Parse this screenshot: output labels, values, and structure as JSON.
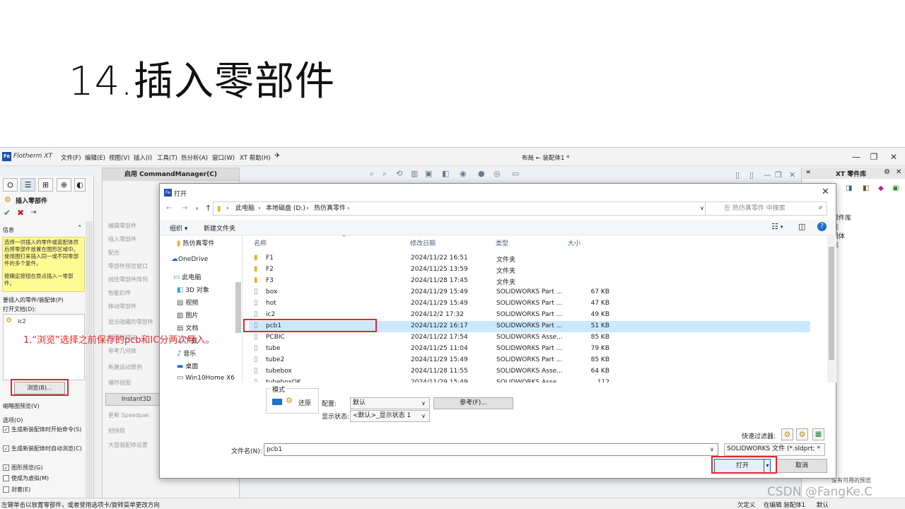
{
  "slide": {
    "title": "14.插入零部件"
  },
  "app": {
    "logo": "Fe",
    "name": "Flotherm XT",
    "menu": [
      "文件(F)",
      "编辑(E)",
      "视图(V)",
      "插入(I)",
      "工具(T)",
      "热分析(A)",
      "窗口(W)",
      "XT 帮助(H)"
    ],
    "document_title": "布局 ← 装配体1 *"
  },
  "property_manager": {
    "title": "插入零部件",
    "info_header": "信息",
    "info_text": "选择一供插入的零件或装配体然后将零部件放置在图形区域中。使用图钉来插入同一或不同零部件的多个复件。",
    "info_text2": "按确定按钮在原点插入一零部件。",
    "part_section": "要插入的零件/装配体(P)",
    "open_docs_label": "打开文档(D):",
    "open_doc_item": "ic2",
    "browse_button": "浏览(B)...",
    "thumbnail_section": "缩略图预览(V)",
    "options_section": "选项(O)",
    "options": [
      {
        "label": "生成新装配体时开始命令(S)",
        "checked": true
      },
      {
        "label": "生成新装配体时自动浏览(C)",
        "checked": true
      },
      {
        "label": "图形预览(G)",
        "checked": true
      },
      {
        "label": "使成为虚拟(M)",
        "checked": false
      },
      {
        "label": "封套(E)",
        "checked": false
      }
    ]
  },
  "command_manager": {
    "header": "启用 CommandManager(C)",
    "items": [
      "编辑零部件",
      "插入零部件",
      "配合",
      "零部件预览窗口",
      "线性零部件阵列",
      "智能扣件",
      "移动零部件",
      "显示隐藏的零部件",
      "装配体特征",
      "参考几何体",
      "新建运动算例",
      "爆炸视图"
    ],
    "instant3d": "Instant3D",
    "items2": [
      "更新 Speedpak",
      "拍快照",
      "大型装配体设置"
    ]
  },
  "right_pane": {
    "title": "XT 零件库",
    "items": [
      "部件库",
      "性",
      "固体",
      "库"
    ],
    "preview_text": "没有可用的预览"
  },
  "status_bar": {
    "left": "左键单击以放置零部件，或者使用选项卡/旋转菜单更改方向",
    "items": [
      "欠定义",
      "在编辑 装配体1",
      "默认"
    ]
  },
  "dialog": {
    "title": "打开",
    "breadcrumb": [
      "此电脑",
      "本地磁盘 (D:)",
      "热仿真零件"
    ],
    "search_placeholder": "在 热仿真零件 中搜索",
    "organize": "组织 ▾",
    "new_folder": "新建文件夹",
    "nav": [
      "热仿真零件",
      "OneDrive",
      "此电脑",
      "3D 对象",
      "视频",
      "图片",
      "文档",
      "下载",
      "音乐",
      "桌面",
      "Win10Home X6"
    ],
    "columns": [
      "名称",
      "修改日期",
      "类型",
      "大小"
    ],
    "files": [
      {
        "name": "F1",
        "date": "2024/11/22 16:51",
        "type": "文件夹",
        "size": "",
        "kind": "folder"
      },
      {
        "name": "F2",
        "date": "2024/11/25 13:59",
        "type": "文件夹",
        "size": "",
        "kind": "folder"
      },
      {
        "name": "F3",
        "date": "2024/11/28 17:45",
        "type": "文件夹",
        "size": "",
        "kind": "folder"
      },
      {
        "name": "box",
        "date": "2024/11/29 15:49",
        "type": "SOLIDWORKS Part ...",
        "size": "67 KB",
        "kind": "file"
      },
      {
        "name": "hot",
        "date": "2024/11/29 15:49",
        "type": "SOLIDWORKS Part ...",
        "size": "47 KB",
        "kind": "file"
      },
      {
        "name": "ic2",
        "date": "2024/12/2 17:32",
        "type": "SOLIDWORKS Part ...",
        "size": "49 KB",
        "kind": "file"
      },
      {
        "name": "pcb1",
        "date": "2024/11/22 16:17",
        "type": "SOLIDWORKS Part ...",
        "size": "51 KB",
        "kind": "file",
        "selected": true
      },
      {
        "name": "PCBIC",
        "date": "2024/11/22 17:54",
        "type": "SOLIDWORKS Asse...",
        "size": "85 KB",
        "kind": "file"
      },
      {
        "name": "tube",
        "date": "2024/11/25 11:04",
        "type": "SOLIDWORKS Part ...",
        "size": "79 KB",
        "kind": "file"
      },
      {
        "name": "tube2",
        "date": "2024/11/29 15:49",
        "type": "SOLIDWORKS Part ...",
        "size": "85 KB",
        "kind": "file"
      },
      {
        "name": "tubebox",
        "date": "2024/11/28 11:55",
        "type": "SOLIDWORKS Asse...",
        "size": "64 KB",
        "kind": "file"
      },
      {
        "name": "tubeboxOK",
        "date": "2024/11/29 15:49",
        "type": "SOLIDWORKS Asse...",
        "size": "112 KB",
        "kind": "file"
      }
    ],
    "mode_label": "模式",
    "restore_label": "还原",
    "config_label": "配置:",
    "config_value": "默认",
    "reference_button": "参考(F)...",
    "display_state_label": "显示状态:",
    "display_state_value": "<默认>_显示状态 1",
    "quick_filter_label": "快速过滤器:",
    "filename_label": "文件名(N):",
    "filename_value": "pcb1",
    "filetype_value": "SOLIDWORKS 文件 (*.sldprt; *",
    "open_button": "打开",
    "cancel_button": "取消"
  },
  "annotation": {
    "text": "1.“浏览”选择之前保存的pcb和IC分两次导入。",
    "color": "#e3262c"
  },
  "watermark": "CSDN @FangKe.C"
}
